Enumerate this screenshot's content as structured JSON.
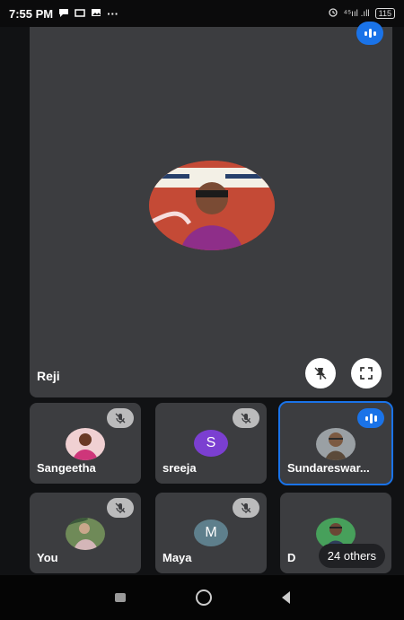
{
  "status_bar": {
    "time": "7:55 PM",
    "dots": "···",
    "signal": "⁴⁵ııl .ıll",
    "battery": "115"
  },
  "main_participant": {
    "name": "Reji",
    "speaking": true
  },
  "participants": [
    {
      "name": "Sangeetha",
      "muted": true,
      "avatar": "photo"
    },
    {
      "name": "sreeja",
      "muted": true,
      "avatar_letter": "S",
      "avatar_color": "#7b3fd1"
    },
    {
      "name": "Sundareswar...",
      "muted": false,
      "speaking": true,
      "avatar": "photo"
    },
    {
      "name": "You",
      "muted": true,
      "avatar": "photo"
    },
    {
      "name": "Maya",
      "muted": true,
      "avatar_letter": "M",
      "avatar_color": "#5e7f8c"
    },
    {
      "name": "D",
      "muted": false,
      "avatar": "photo"
    }
  ],
  "others_label": "24 others",
  "colors": {
    "accent": "#1a73e8",
    "tile_bg": "#3c3d40",
    "background": "#111214"
  },
  "icons": {
    "mute": "mic-off-icon",
    "pin": "pin-off-icon",
    "fullscreen": "fullscreen-icon",
    "speaking": "audio-bars-icon"
  }
}
